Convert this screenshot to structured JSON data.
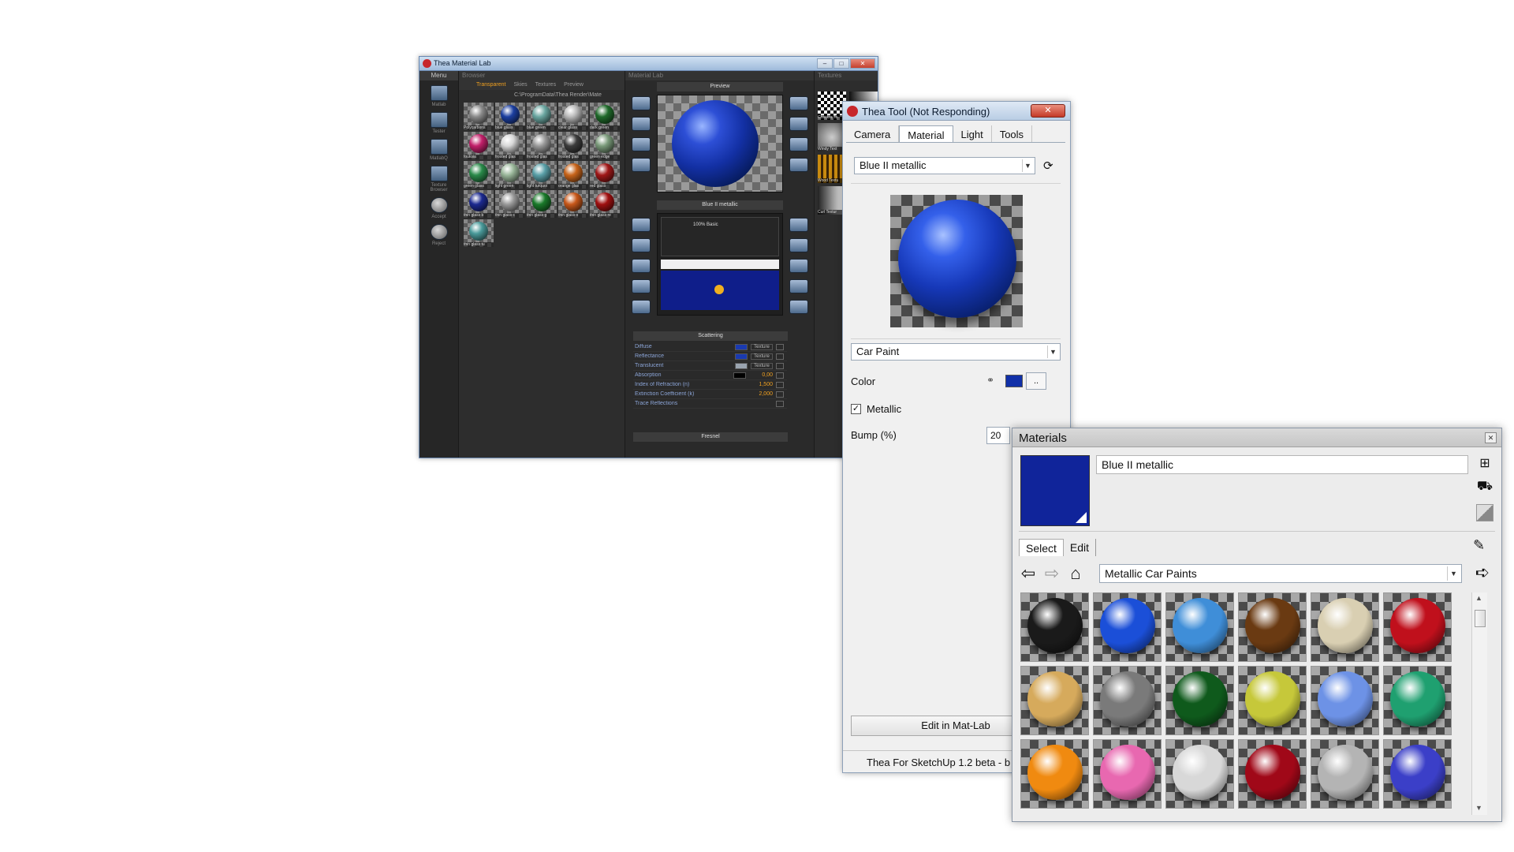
{
  "matlab": {
    "title": "Thea Material Lab",
    "menu_header": "Menu",
    "menu_items": [
      "Matlab",
      "Tester",
      "MatlabQ",
      "Texture Browser",
      "Accept",
      "Reject"
    ],
    "browser_header": "Browser",
    "browser_tabs": [
      "Transparent",
      "Skies",
      "Textures",
      "Preview"
    ],
    "browser_path": "C:\\ProgramData\\Thea Render\\Mate",
    "thumbs": [
      {
        "label": "Polycarbons",
        "color": "#8a8a8a"
      },
      {
        "label": "blue glass",
        "color": "#1c3fa0"
      },
      {
        "label": "blue green",
        "color": "#6aa6a0"
      },
      {
        "label": "clear glass",
        "color": "#b9b9b9"
      },
      {
        "label": "dark green",
        "color": "#1f6a2a"
      },
      {
        "label": "fouksia",
        "color": "#c2206a"
      },
      {
        "label": "frosted glas",
        "color": "#d8d8d8"
      },
      {
        "label": "frosted glas",
        "color": "#9a9a9a"
      },
      {
        "label": "frosted glas",
        "color": "#3c3c3c"
      },
      {
        "label": "green edge",
        "color": "#7a9a7a"
      },
      {
        "label": "green glass",
        "color": "#2a8a4a"
      },
      {
        "label": "light green",
        "color": "#9ab79a"
      },
      {
        "label": "light turquoi",
        "color": "#5aa0a8"
      },
      {
        "label": "orange glas",
        "color": "#c8641a"
      },
      {
        "label": "red glass",
        "color": "#a01818"
      },
      {
        "label": "thin glass b",
        "color": "#1c2a90"
      },
      {
        "label": "thin glass c",
        "color": "#9a9a9a"
      },
      {
        "label": "thin glass g",
        "color": "#1a7a2a"
      },
      {
        "label": "thin glass o",
        "color": "#c8581a"
      },
      {
        "label": "thin glass re",
        "color": "#a01010"
      },
      {
        "label": "thin glass tu",
        "color": "#4a9a9a"
      }
    ],
    "lab_header": "Material Lab",
    "preview_header": "Preview",
    "left_tools": [
      "Clear",
      "Revert",
      "Open",
      "Save"
    ],
    "right_tools": [
      "Options",
      "Room",
      "Refresh",
      "Stop"
    ],
    "material_name": "Blue II metallic",
    "layer_caption": "100% Basic",
    "component_left": [
      "General",
      "Clipping",
      "Displace",
      "Emitter",
      "Medium"
    ],
    "component_right": [
      "Basic",
      "Glossy",
      "SSS",
      "ThinFilm",
      "Coating"
    ],
    "bottom_tools": [
      "Delete",
      "Move",
      "Layer",
      "Scatter",
      "Struct"
    ],
    "scattering_header": "Scattering",
    "props": [
      {
        "name": "Diffuse",
        "swatch": "#1a3ab0",
        "tex": "Texture"
      },
      {
        "name": "Reflectance",
        "swatch": "#1a3ab0",
        "tex": "Texture"
      },
      {
        "name": "Translucent",
        "swatch": "#9aa4b0",
        "tex": "Texture"
      },
      {
        "name": "Absorption",
        "swatch": "#000000",
        "value": "0,00"
      },
      {
        "name": "Index of Refraction (n)",
        "value": "1,500"
      },
      {
        "name": "Extinction Coefficient (k)",
        "value": "2,000"
      },
      {
        "name": "Trace Reflections"
      }
    ],
    "fresnel_header": "Fresnel",
    "textures_header": "Textures",
    "textures": [
      {
        "label": "Checker Te"
      },
      {
        "label": "Gradient T"
      },
      {
        "label": "Windy Text"
      },
      {
        "label": "Marble Tex"
      },
      {
        "label": "Wood Textu"
      },
      {
        "label": "Wireframe"
      },
      {
        "label": "Curl Textur"
      },
      {
        "label": "Tile Textur"
      }
    ]
  },
  "tool": {
    "title": "Thea Tool (Not Responding)",
    "tabs": [
      "Camera",
      "Material",
      "Light",
      "Tools"
    ],
    "active_tab": "Material",
    "material_select": "Blue II metallic",
    "type_select": "Car Paint",
    "color_label": "Color",
    "color_value": "#1130a8",
    "dots_label": "..",
    "metallic_label": "Metallic",
    "metallic_checked": true,
    "bump_label": "Bump (%)",
    "bump_value": "20",
    "edit_button": "Edit in Mat-Lab",
    "status": "Thea For SketchUp 1.2 beta - b"
  },
  "materials": {
    "title": "Materials",
    "name_value": "Blue II metallic",
    "swatch_color": "#10249a",
    "tabs": [
      "Select",
      "Edit"
    ],
    "active_tab": "Select",
    "library": "Metallic Car Paints",
    "balls": [
      {
        "color": "#1a1a1a"
      },
      {
        "color": "#1b4fd8"
      },
      {
        "color": "#3f8ed8"
      },
      {
        "color": "#6a3a12"
      },
      {
        "color": "#d9cfb2"
      },
      {
        "color": "#c0101c"
      },
      {
        "color": "#d6aa5c"
      },
      {
        "color": "#7a7a7a"
      },
      {
        "color": "#0f5a1c"
      },
      {
        "color": "#c6c83a"
      },
      {
        "color": "#6d92e6"
      },
      {
        "color": "#1fa070"
      },
      {
        "color": "#f08a10"
      },
      {
        "color": "#e868b0"
      },
      {
        "color": "#d8d8d8"
      },
      {
        "color": "#a00818"
      },
      {
        "color": "#b4b4b4"
      },
      {
        "color": "#3b3fc8"
      }
    ]
  }
}
